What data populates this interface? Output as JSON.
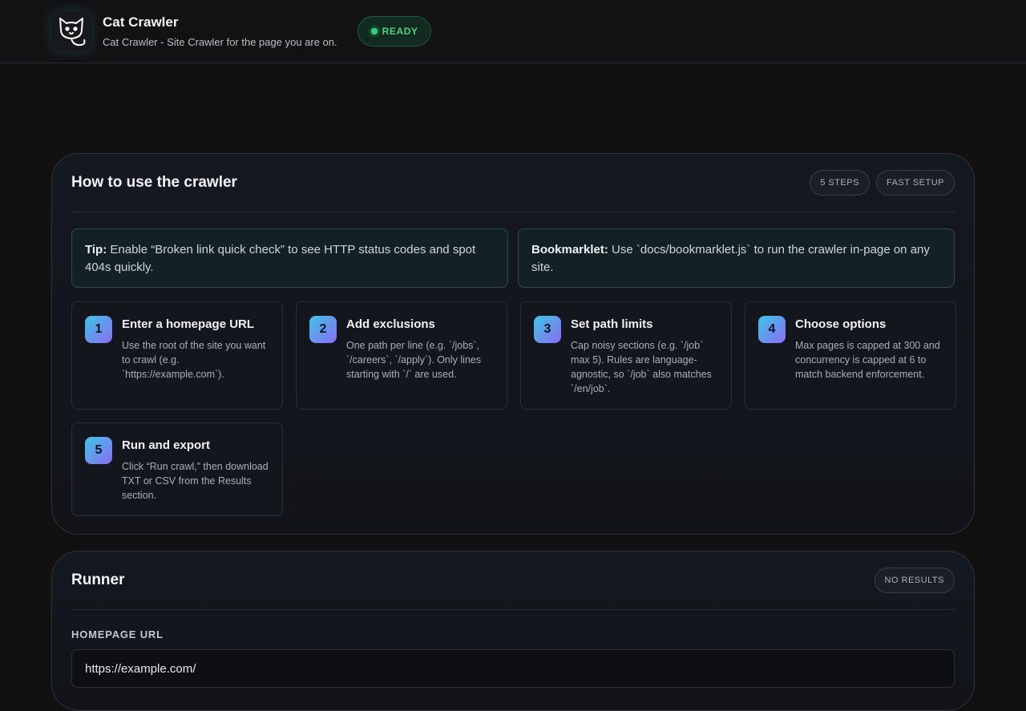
{
  "header": {
    "title": "Cat Crawler",
    "subtitle": "Cat Crawler - Site Crawler for the page you are on.",
    "status": "READY",
    "logo_icon": "cat-icon"
  },
  "howto": {
    "title": "How to use the crawler",
    "chips": [
      "5 STEPS",
      "FAST SETUP"
    ],
    "tips": [
      {
        "label": "Tip:",
        "text": " Enable “Broken link quick check” to see HTTP status codes and spot 404s quickly."
      },
      {
        "label": "Bookmarklet:",
        "text": " Use `docs/bookmarklet.js` to run the crawler in-page on any site."
      }
    ],
    "steps": [
      {
        "num": "1",
        "title": "Enter a homepage URL",
        "desc": "Use the root of the site you want to crawl (e.g. `https://example.com`)."
      },
      {
        "num": "2",
        "title": "Add exclusions",
        "desc": "One path per line (e.g. `/jobs`, `/careers`, `/apply`). Only lines starting with `/` are used."
      },
      {
        "num": "3",
        "title": "Set path limits",
        "desc": "Cap noisy sections (e.g. `/job` max 5). Rules are language-agnostic, so `/job` also matches `/en/job`."
      },
      {
        "num": "4",
        "title": "Choose options",
        "desc": "Max pages is capped at 300 and concurrency is capped at 6 to match backend enforcement."
      },
      {
        "num": "5",
        "title": "Run and export",
        "desc": "Click “Run crawl,” then download TXT or CSV from the Results section."
      }
    ]
  },
  "runner": {
    "title": "Runner",
    "chip": "NO RESULTS",
    "homepage_label": "HOMEPAGE URL",
    "homepage_value": "https://example.com/"
  }
}
